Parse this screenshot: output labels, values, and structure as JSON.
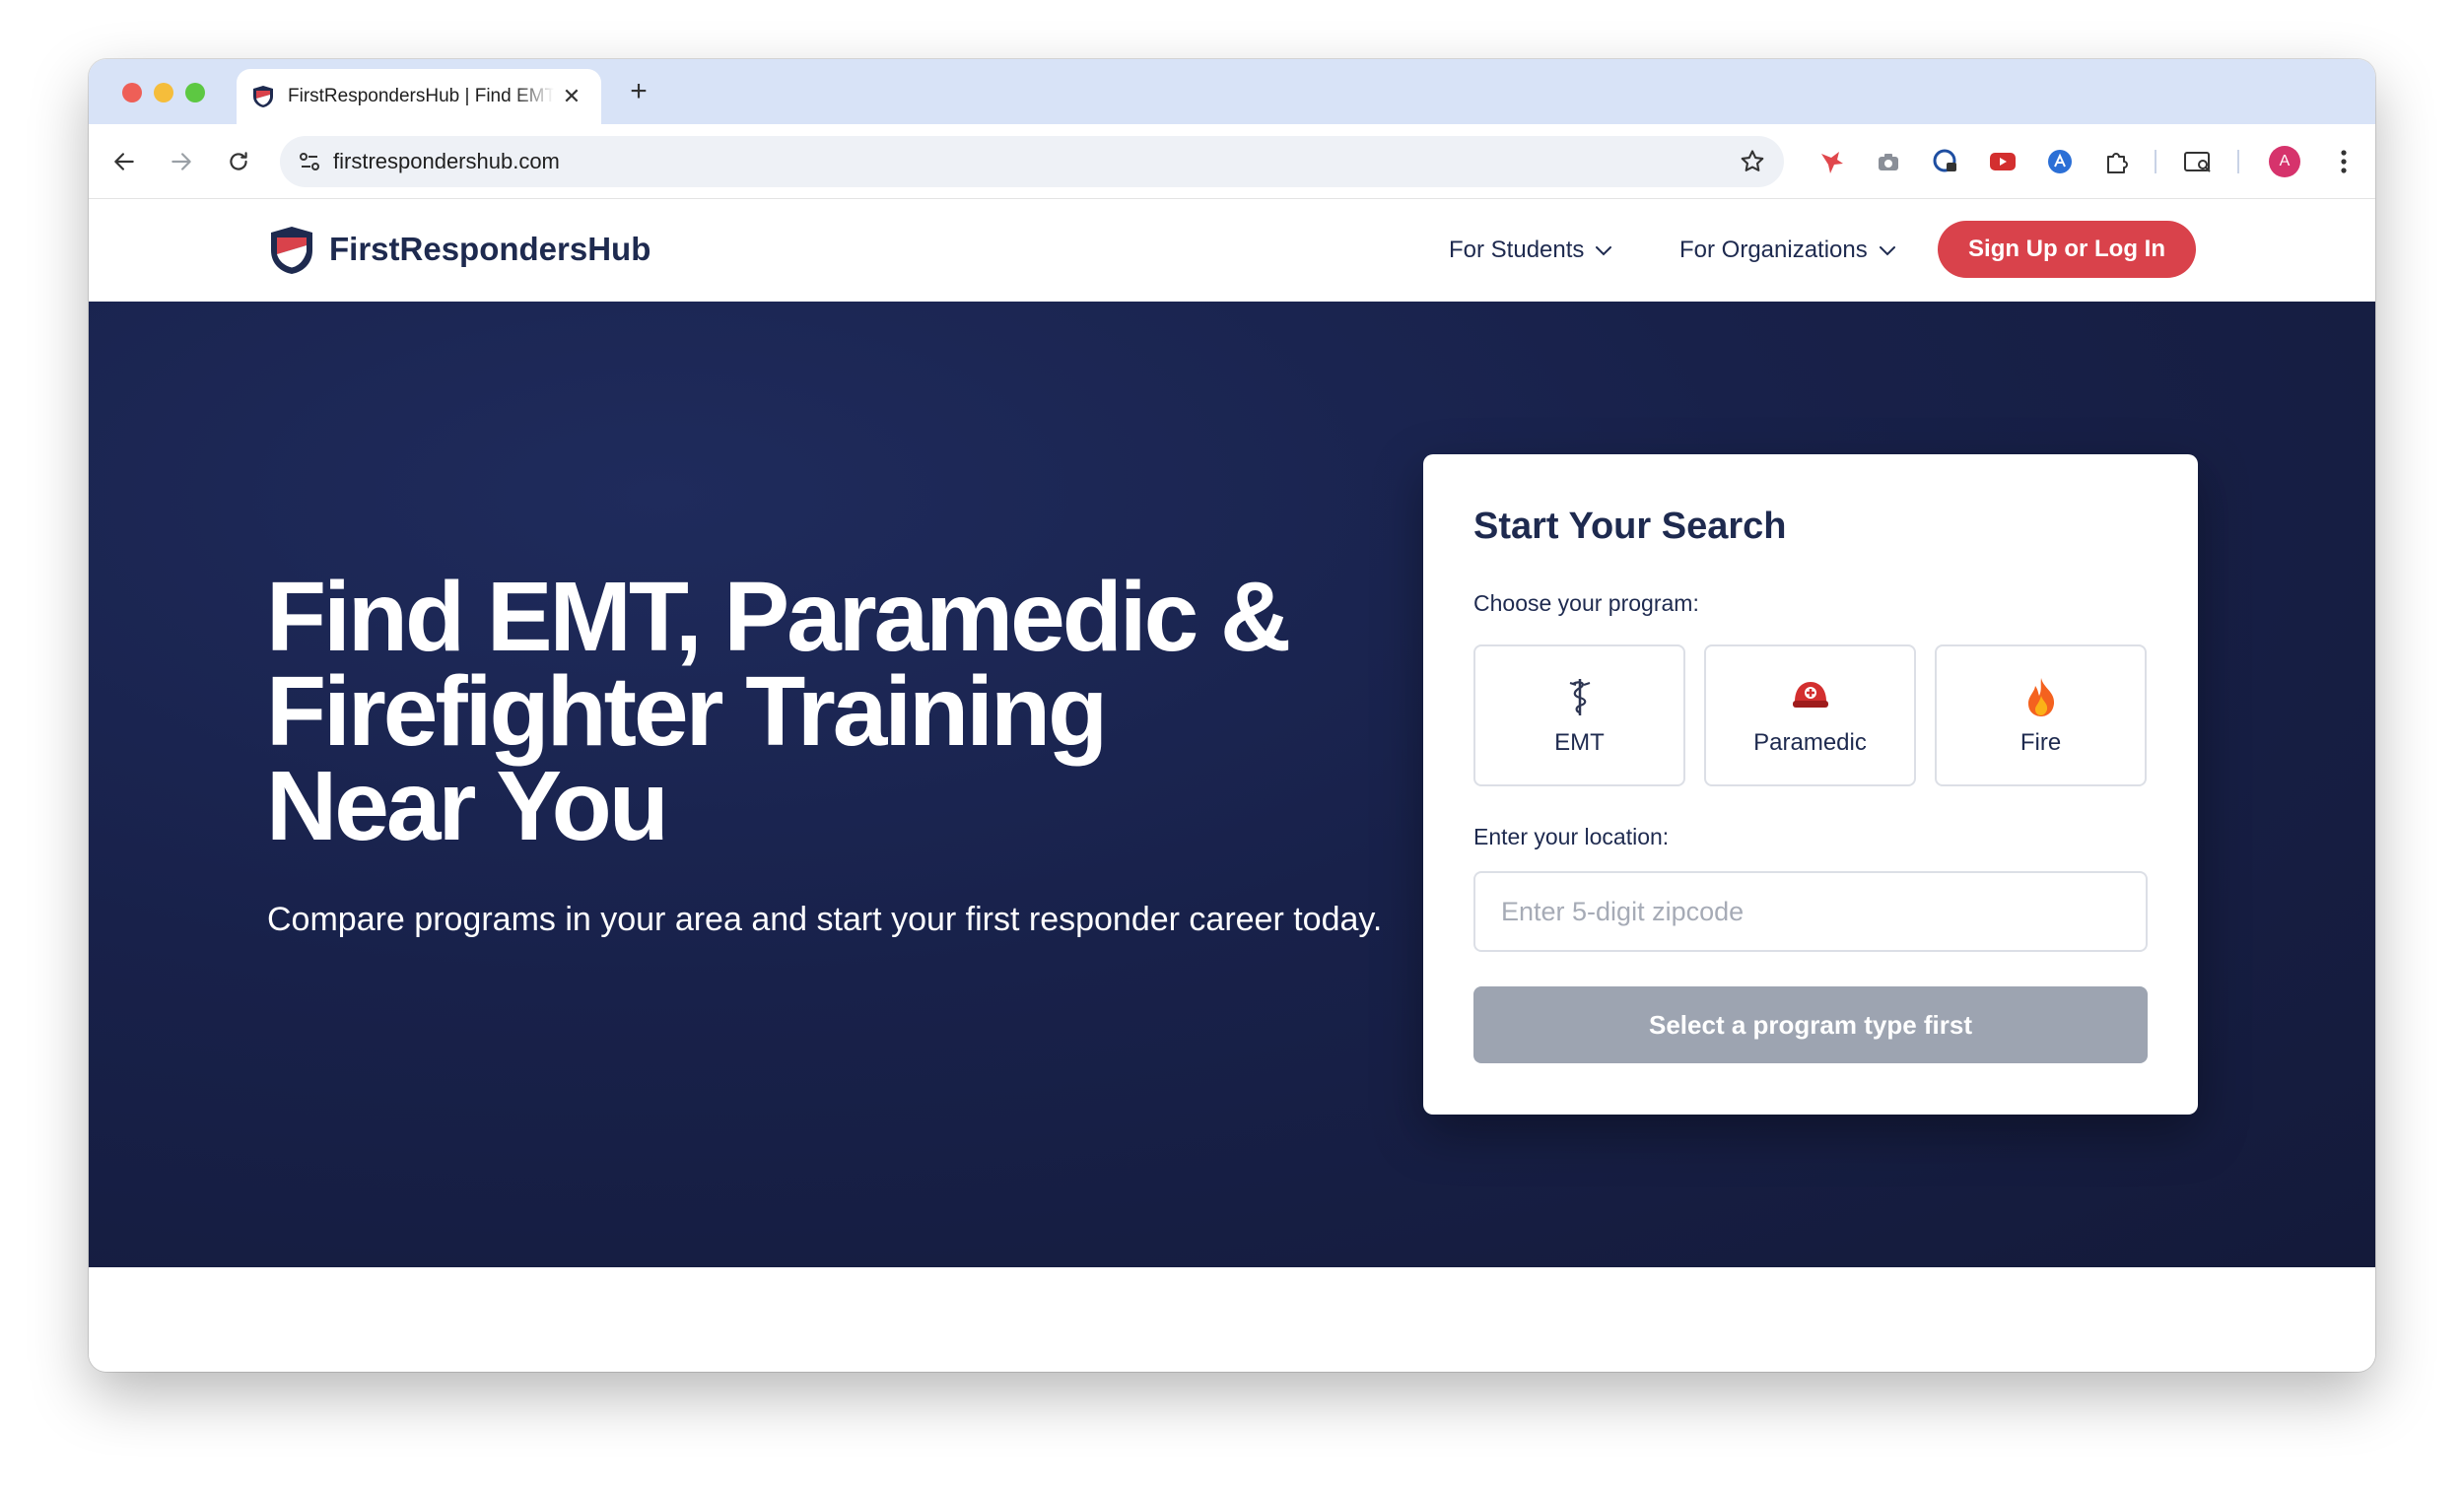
{
  "browser": {
    "tab_title": "FirstRespondersHub | Find EMT, Paramedic & Firefighter Training",
    "tab_close": "✕",
    "new_tab": "+",
    "url": "firstrespondershub.com",
    "avatar_initial": "A"
  },
  "site": {
    "brand": "FirstRespondersHub",
    "nav": [
      {
        "label": "For Students"
      },
      {
        "label": "For Organizations"
      }
    ],
    "signup_label": "Sign Up or Log In"
  },
  "hero": {
    "title": "Find EMT, Paramedic & Firefighter Training Near You",
    "subtitle": "Compare programs in your area and start your first responder career today."
  },
  "search": {
    "title": "Start Your Search",
    "program_label": "Choose your program:",
    "programs": [
      {
        "label": "EMT",
        "icon": "caduceus-icon"
      },
      {
        "label": "Paramedic",
        "icon": "helmet-icon"
      },
      {
        "label": "Fire",
        "icon": "fire-icon"
      }
    ],
    "location_label": "Enter your location:",
    "zip_placeholder": "Enter 5-digit zipcode",
    "zip_value": "",
    "submit_label": "Select a program type first"
  },
  "colors": {
    "accent": "#d9424b",
    "navy": "#1e2a4f",
    "hero_bg": "#18214a",
    "disabled_button": "#9da4b1"
  }
}
